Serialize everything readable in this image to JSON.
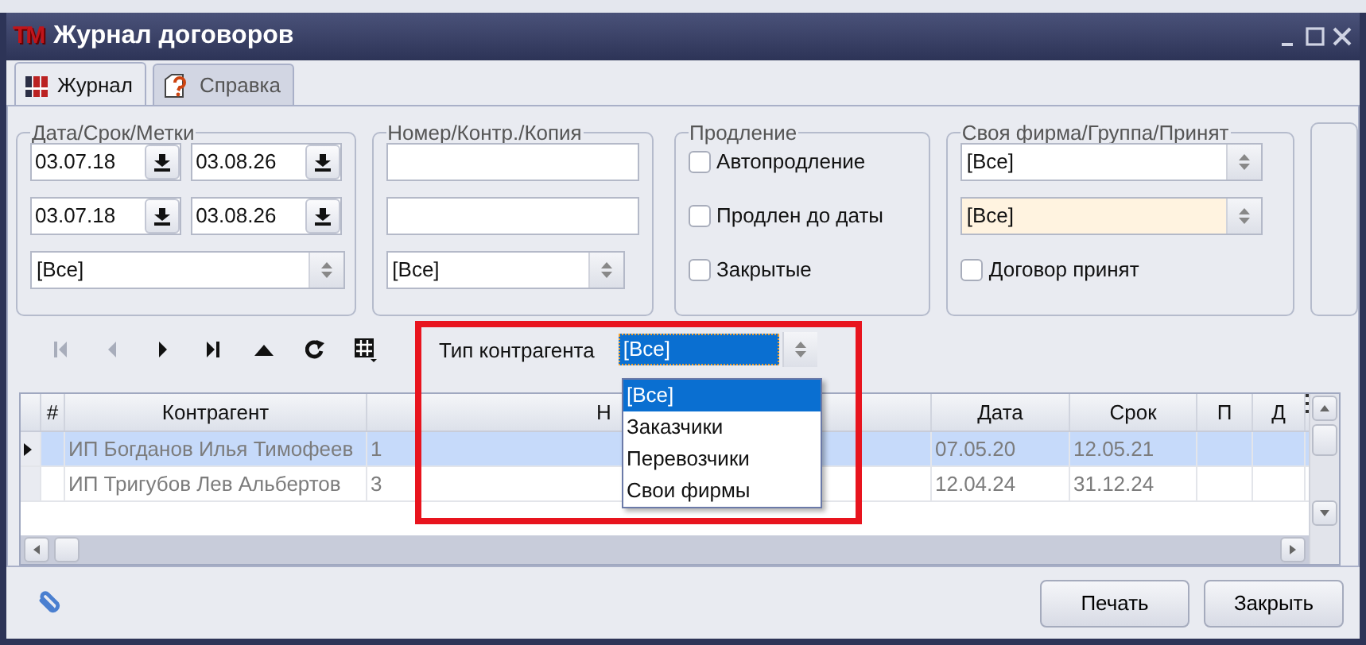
{
  "window": {
    "logo": "ТМ",
    "title": "Журнал договоров"
  },
  "tabs": [
    {
      "label": "Журнал",
      "selected": true
    },
    {
      "label": "Справка",
      "selected": false
    }
  ],
  "date_group": {
    "title": "Дата/Срок/Метки",
    "ranges": [
      {
        "from": "03.07.18",
        "to": "03.08.26"
      },
      {
        "from": "03.07.18",
        "to": "03.08.26"
      }
    ],
    "select": "[Все]"
  },
  "number_group": {
    "title": "Номер/Контр./Копия",
    "select": "[Все]"
  },
  "renewal_group": {
    "title": "Продление",
    "options": [
      {
        "label": "Автопродление",
        "checked": false
      },
      {
        "label": "Продлен до даты",
        "checked": false
      },
      {
        "label": "Закрытые",
        "checked": false
      }
    ]
  },
  "firm_group": {
    "title": "Своя фирма/Группа/Принят",
    "selects": [
      {
        "value": "[Все]",
        "highlighted": false
      },
      {
        "value": "[Все]",
        "highlighted": true
      }
    ],
    "option": {
      "label": "Договор принят",
      "checked": false
    }
  },
  "navigator": [
    {
      "kind": "first",
      "disabled": true
    },
    {
      "kind": "prev",
      "disabled": true
    },
    {
      "kind": "next",
      "disabled": false
    },
    {
      "kind": "last",
      "disabled": false
    },
    {
      "kind": "up",
      "disabled": false
    },
    {
      "kind": "refresh",
      "disabled": false
    },
    {
      "kind": "grid",
      "disabled": false
    }
  ],
  "contractor_type": {
    "label": "Тип контрагента",
    "value": "[Все]",
    "options": [
      {
        "label": "[Все]",
        "selected": true
      },
      {
        "label": "Заказчики",
        "selected": false
      },
      {
        "label": "Перевозчики",
        "selected": false
      },
      {
        "label": "Свои фирмы",
        "selected": false
      }
    ]
  },
  "table": {
    "columns": [
      "#",
      "Контрагент",
      "Н",
      "Дата",
      "Срок",
      "П",
      "Д"
    ],
    "rows": [
      {
        "selected": true,
        "cells": [
          "",
          "ИП Богданов Илья Тимофеев",
          "1",
          "07.05.20",
          "12.05.21"
        ]
      },
      {
        "selected": false,
        "cells": [
          "",
          "ИП Тригубов Лев Альбертов",
          "3",
          "12.04.24",
          "31.12.24"
        ]
      }
    ]
  },
  "buttons": [
    "Печать",
    "Закрыть"
  ]
}
